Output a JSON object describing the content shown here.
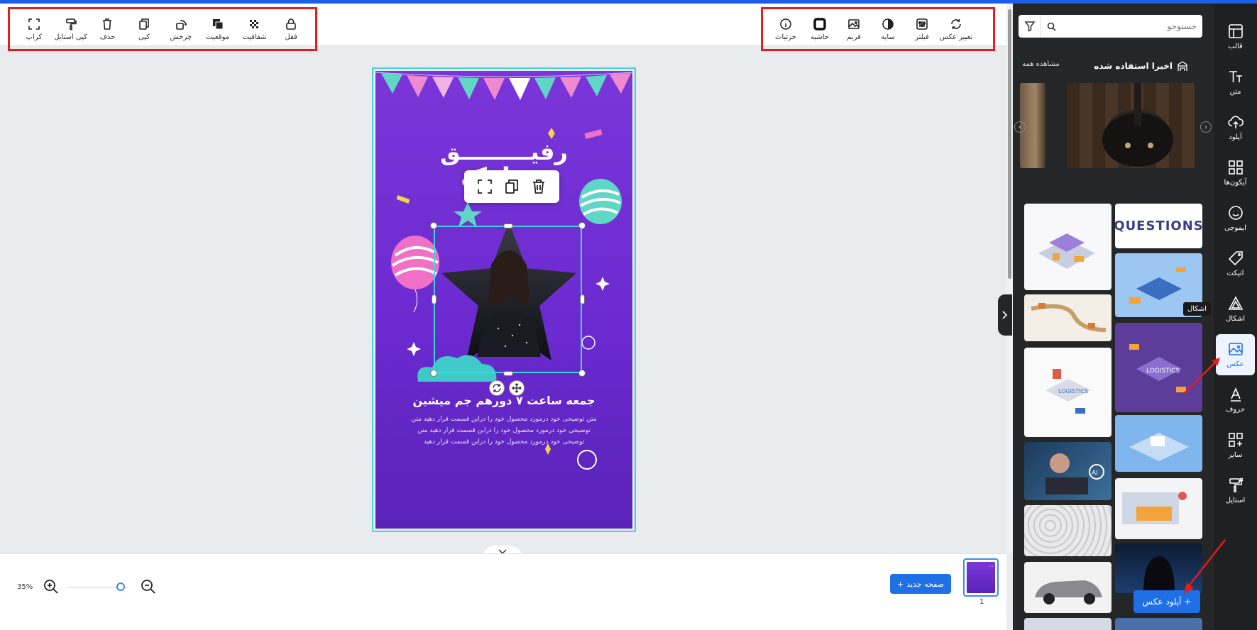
{
  "toolbar": {
    "left_tools": [
      {
        "label": "قفل",
        "icon": "lock-icon"
      },
      {
        "label": "شفافیت",
        "icon": "transparency-icon"
      },
      {
        "label": "موقعیت",
        "icon": "position-icon"
      },
      {
        "label": "چرخش",
        "icon": "rotate-icon"
      },
      {
        "label": "کپی",
        "icon": "copy-icon"
      },
      {
        "label": "حذف",
        "icon": "trash-icon"
      },
      {
        "label": "کپی استایل",
        "icon": "paint-roller-icon"
      },
      {
        "label": "کراپ",
        "icon": "crop-icon"
      }
    ],
    "right_tools": [
      {
        "label": "تغییر عکس",
        "icon": "replace-icon"
      },
      {
        "label": "فیلتر",
        "icon": "filter-sliders-icon"
      },
      {
        "label": "سایه",
        "icon": "shadow-icon"
      },
      {
        "label": "فریم",
        "icon": "frame-icon"
      },
      {
        "label": "حاشیه",
        "icon": "border-icon"
      },
      {
        "label": "جزئیات",
        "icon": "info-icon"
      }
    ]
  },
  "design": {
    "headline1": "رفیـــــــــق",
    "headline2": "تـ       ـارک",
    "subtitle": "جمعه ساعت ۷ دورهم جم میشین",
    "body": "متن توضیحی خود درمورد محصول خود را دراین قسمت قرار دهید متن توضیحی خود درمورد محصول خود را دراین قسمت قرار دهید متن توضیحی خود درمورد محصول خود را دراین قسمت قرار دهید"
  },
  "bottombar": {
    "zoom": "35%",
    "zoom_fraction": 0.12,
    "new_page": "صفحه جدید",
    "page_number": "1"
  },
  "panel": {
    "search_placeholder": "جستوجو",
    "recent_title": "اخیرا استفاده شده",
    "view_all": "مشاهده همه",
    "upload_button": "آپلود عکس",
    "photos": [
      "QUESTIONS"
    ]
  },
  "nav": [
    {
      "label": "قالب",
      "icon": "template-icon"
    },
    {
      "label": "متن",
      "icon": "text-icon"
    },
    {
      "label": "آپلود",
      "icon": "upload-icon"
    },
    {
      "label": "آیکون‌ها",
      "icon": "icons-grid-icon"
    },
    {
      "label": "ایموجی",
      "icon": "emoji-icon"
    },
    {
      "label": "اتیکت",
      "icon": "tag-icon"
    },
    {
      "label": "اشکال",
      "icon": "shapes-icon"
    },
    {
      "label": "عکس",
      "icon": "image-icon"
    },
    {
      "label": "حروف",
      "icon": "letters-icon"
    },
    {
      "label": "سایر",
      "icon": "more-grid-icon"
    },
    {
      "label": "استایل",
      "icon": "style-icon"
    }
  ],
  "tooltip": "اشکال",
  "colors": {
    "accent": "#1f6fe5",
    "highlight": "#e11d1d",
    "selection": "#3fd6d9",
    "panel": "#252627"
  }
}
